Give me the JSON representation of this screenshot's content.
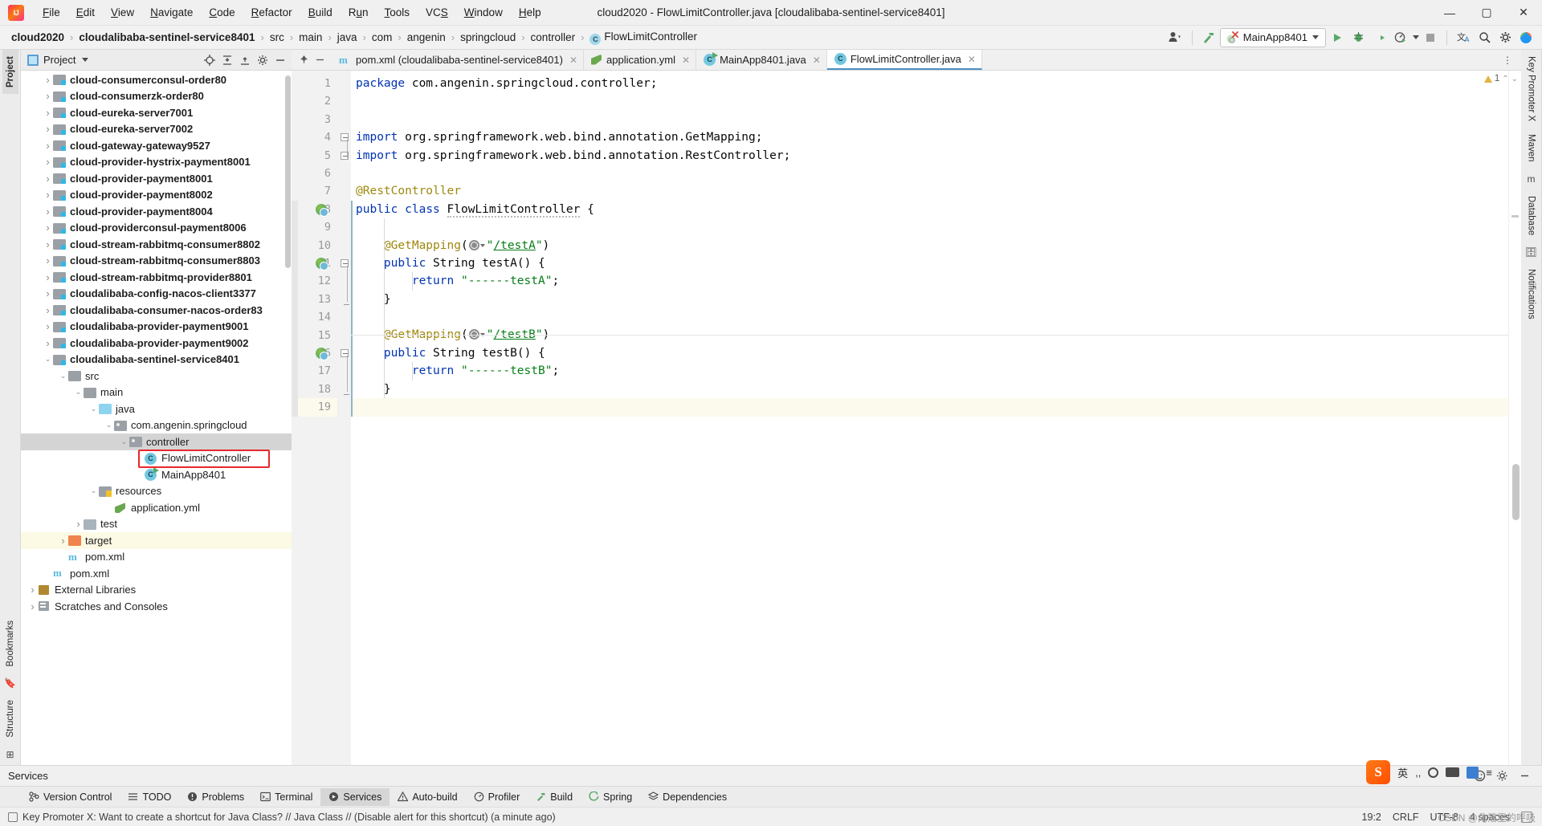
{
  "window": {
    "title": "cloud2020 - FlowLimitController.java [cloudalibaba-sentinel-service8401]",
    "minimize": "—",
    "maximize": "▢",
    "close": "✕"
  },
  "menu": [
    {
      "label": "File"
    },
    {
      "label": "Edit"
    },
    {
      "label": "View"
    },
    {
      "label": "Navigate"
    },
    {
      "label": "Code"
    },
    {
      "label": "Refactor"
    },
    {
      "label": "Build"
    },
    {
      "label": "Run"
    },
    {
      "label": "Tools"
    },
    {
      "label": "VCS"
    },
    {
      "label": "Window"
    },
    {
      "label": "Help"
    }
  ],
  "breadcrumbs": [
    {
      "label": "cloud2020",
      "bold": true
    },
    {
      "label": "cloudalibaba-sentinel-service8401",
      "bold": true
    },
    {
      "label": "src",
      "bold": false
    },
    {
      "label": "main",
      "bold": false
    },
    {
      "label": "java",
      "bold": false
    },
    {
      "label": "com",
      "bold": false
    },
    {
      "label": "angenin",
      "bold": false
    },
    {
      "label": "springcloud",
      "bold": false
    },
    {
      "label": "controller",
      "bold": false
    },
    {
      "label": "FlowLimitController",
      "bold": false,
      "icon": "class-icon",
      "badge": "C"
    }
  ],
  "nav_toolbar": {
    "run_config": "MainApp8401",
    "icons": [
      "user-avatar-icon",
      "hammer-build-icon",
      "run-icon",
      "debug-icon",
      "run-with-coverage-icon",
      "profiler-icon",
      "stop-icon",
      "translate-icon",
      "search-everywhere-icon",
      "settings-gear-icon",
      "updates-icon"
    ]
  },
  "left_rail": {
    "tabs": [
      "Project",
      "Bookmarks",
      "Structure"
    ]
  },
  "right_rail": {
    "tabs": [
      "Key Promoter X",
      "Maven",
      "Database",
      "Notifications"
    ]
  },
  "project_panel": {
    "title": "Project",
    "actions": [
      "locate-icon",
      "expand-all-icon",
      "collapse-all-icon",
      "settings-icon",
      "hide-icon"
    ],
    "tree": [
      {
        "label": "cloud-consumerconsul-order80",
        "indent": 1,
        "arrow": "collapsed",
        "icon": "module-folder",
        "bold": true
      },
      {
        "label": "cloud-consumerzk-order80",
        "indent": 1,
        "arrow": "collapsed",
        "icon": "module-folder",
        "bold": true
      },
      {
        "label": "cloud-eureka-server7001",
        "indent": 1,
        "arrow": "collapsed",
        "icon": "module-folder",
        "bold": true
      },
      {
        "label": "cloud-eureka-server7002",
        "indent": 1,
        "arrow": "collapsed",
        "icon": "module-folder",
        "bold": true
      },
      {
        "label": "cloud-gateway-gateway9527",
        "indent": 1,
        "arrow": "collapsed",
        "icon": "module-folder",
        "bold": true
      },
      {
        "label": "cloud-provider-hystrix-payment8001",
        "indent": 1,
        "arrow": "collapsed",
        "icon": "module-folder",
        "bold": true
      },
      {
        "label": "cloud-provider-payment8001",
        "indent": 1,
        "arrow": "collapsed",
        "icon": "module-folder",
        "bold": true
      },
      {
        "label": "cloud-provider-payment8002",
        "indent": 1,
        "arrow": "collapsed",
        "icon": "module-folder",
        "bold": true
      },
      {
        "label": "cloud-provider-payment8004",
        "indent": 1,
        "arrow": "collapsed",
        "icon": "module-folder",
        "bold": true
      },
      {
        "label": "cloud-providerconsul-payment8006",
        "indent": 1,
        "arrow": "collapsed",
        "icon": "module-folder",
        "bold": true
      },
      {
        "label": "cloud-stream-rabbitmq-consumer8802",
        "indent": 1,
        "arrow": "collapsed",
        "icon": "module-folder",
        "bold": true
      },
      {
        "label": "cloud-stream-rabbitmq-consumer8803",
        "indent": 1,
        "arrow": "collapsed",
        "icon": "module-folder",
        "bold": true
      },
      {
        "label": "cloud-stream-rabbitmq-provider8801",
        "indent": 1,
        "arrow": "collapsed",
        "icon": "module-folder",
        "bold": true
      },
      {
        "label": "cloudalibaba-config-nacos-client3377",
        "indent": 1,
        "arrow": "collapsed",
        "icon": "module-folder",
        "bold": true
      },
      {
        "label": "cloudalibaba-consumer-nacos-order83",
        "indent": 1,
        "arrow": "collapsed",
        "icon": "module-folder",
        "bold": true
      },
      {
        "label": "cloudalibaba-provider-payment9001",
        "indent": 1,
        "arrow": "collapsed",
        "icon": "module-folder",
        "bold": true
      },
      {
        "label": "cloudalibaba-provider-payment9002",
        "indent": 1,
        "arrow": "collapsed",
        "icon": "module-folder",
        "bold": true
      },
      {
        "label": "cloudalibaba-sentinel-service8401",
        "indent": 1,
        "arrow": "expanded",
        "icon": "module-folder",
        "bold": true
      },
      {
        "label": "src",
        "indent": 2,
        "arrow": "expanded",
        "icon": "plain-folder",
        "bold": false
      },
      {
        "label": "main",
        "indent": 3,
        "arrow": "expanded",
        "icon": "plain-folder",
        "bold": false
      },
      {
        "label": "java",
        "indent": 4,
        "arrow": "expanded",
        "icon": "source-folder",
        "bold": false
      },
      {
        "label": "com.angenin.springcloud",
        "indent": 5,
        "arrow": "expanded",
        "icon": "package-folder",
        "bold": false
      },
      {
        "label": "controller",
        "indent": 6,
        "arrow": "expanded",
        "icon": "package-folder",
        "bold": false,
        "selected": true
      },
      {
        "label": "FlowLimitController",
        "indent": 7,
        "arrow": "none",
        "icon": "java-class",
        "bold": false,
        "annotated": true
      },
      {
        "label": "MainApp8401",
        "indent": 7,
        "arrow": "none",
        "icon": "java-class-runnable",
        "bold": false
      },
      {
        "label": "resources",
        "indent": 4,
        "arrow": "expanded",
        "icon": "resources-folder",
        "bold": false
      },
      {
        "label": "application.yml",
        "indent": 5,
        "arrow": "none",
        "icon": "yaml-file",
        "bold": false
      },
      {
        "label": "test",
        "indent": 3,
        "arrow": "collapsed",
        "icon": "test-folder",
        "bold": false
      },
      {
        "label": "target",
        "indent": 2,
        "arrow": "collapsed",
        "icon": "target-folder",
        "bold": false,
        "excluded": true
      },
      {
        "label": "pom.xml",
        "indent": 2,
        "arrow": "none",
        "icon": "maven-file",
        "bold": false
      },
      {
        "label": "pom.xml",
        "indent": 1,
        "arrow": "none",
        "icon": "maven-file",
        "bold": false
      },
      {
        "label": "External Libraries",
        "indent": 0,
        "arrow": "collapsed",
        "icon": "library",
        "bold": false
      },
      {
        "label": "Scratches and Consoles",
        "indent": 0,
        "arrow": "collapsed",
        "icon": "scratch",
        "bold": false
      }
    ]
  },
  "editor_tabs": [
    {
      "label": "pom.xml (cloudalibaba-sentinel-service8401)",
      "icon": "maven-icon",
      "active": false,
      "closable": true
    },
    {
      "label": "application.yml",
      "icon": "yaml-icon",
      "active": false,
      "closable": true
    },
    {
      "label": "MainApp8401.java",
      "icon": "java-runnable-icon",
      "active": false,
      "closable": true
    },
    {
      "label": "FlowLimitController.java",
      "icon": "java-class-icon",
      "active": true,
      "closable": true
    }
  ],
  "editor": {
    "inspection_warnings": "1",
    "lines": [
      {
        "n": 1,
        "text": "package com.angenin.springcloud.controller;"
      },
      {
        "n": 2,
        "text": ""
      },
      {
        "n": 3,
        "text": ""
      },
      {
        "n": 4,
        "text": "import org.springframework.web.bind.annotation.GetMapping;"
      },
      {
        "n": 5,
        "text": "import org.springframework.web.bind.annotation.RestController;"
      },
      {
        "n": 6,
        "text": ""
      },
      {
        "n": 7,
        "text": "@RestController"
      },
      {
        "n": 8,
        "text": "public class FlowLimitController {"
      },
      {
        "n": 9,
        "text": ""
      },
      {
        "n": 10,
        "text": "    @GetMapping(\"/testA\")"
      },
      {
        "n": 11,
        "text": "    public String testA() {"
      },
      {
        "n": 12,
        "text": "        return \"------testA\";"
      },
      {
        "n": 13,
        "text": "    }"
      },
      {
        "n": 14,
        "text": ""
      },
      {
        "n": 15,
        "text": "    @GetMapping(\"/testB\")"
      },
      {
        "n": 16,
        "text": "    public String testB() {"
      },
      {
        "n": 17,
        "text": "        return \"------testB\";"
      },
      {
        "n": 18,
        "text": "    }"
      },
      {
        "n": 19,
        "text": "}"
      }
    ]
  },
  "services_bar": {
    "title": "Services"
  },
  "tool_window_buttons": [
    {
      "label": "Version Control",
      "icon": "branch-icon",
      "active": false
    },
    {
      "label": "TODO",
      "icon": "list-icon",
      "active": false
    },
    {
      "label": "Problems",
      "icon": "error-icon",
      "active": false
    },
    {
      "label": "Terminal",
      "icon": "terminal-icon",
      "active": false
    },
    {
      "label": "Services",
      "icon": "services-icon",
      "active": true
    },
    {
      "label": "Auto-build",
      "icon": "warning-icon",
      "active": false
    },
    {
      "label": "Profiler",
      "icon": "profiler-icon",
      "active": false
    },
    {
      "label": "Build",
      "icon": "hammer-icon",
      "active": false
    },
    {
      "label": "Spring",
      "icon": "spring-icon",
      "active": false
    },
    {
      "label": "Dependencies",
      "icon": "layers-icon",
      "active": false
    }
  ],
  "status_bar": {
    "message": "Key Promoter X: Want to create a shortcut for Java Class? // Java Class // (Disable alert for this shortcut) (a minute ago)",
    "caret_position": "19:2",
    "line_separator": "CRLF",
    "encoding": "UTF-8",
    "indent": "4 spaces",
    "lock_icon": "lock-icon"
  },
  "ime_widget": {
    "logo": "S",
    "mode": "英",
    "items": [
      "punctuation-icon",
      "microphone-icon",
      "keyboard-icon",
      "toolbox-icon",
      "menu-icon"
    ]
  },
  "watermark": "CSDN @角落里的呼吸"
}
